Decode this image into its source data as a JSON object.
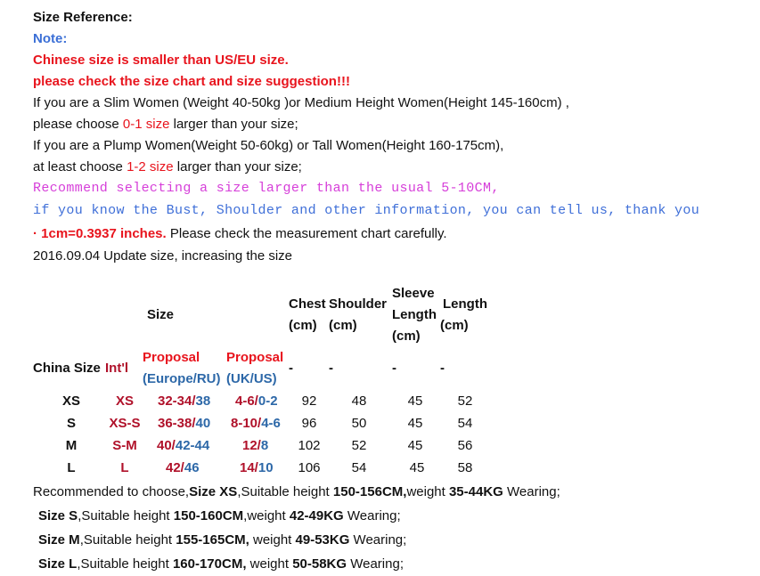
{
  "header": {
    "title": "Size Reference:",
    "note": "Note:",
    "warning1": "Chinese size is smaller than US/EU size.",
    "warning2": "please check the size chart and size suggestion!!!"
  },
  "advice": {
    "slim_line": "If you are a Slim Women (Weight 40-50kg )or Medium Height Women(Height 145-160cm) ,",
    "slim_pre": "please choose ",
    "slim_range": "0-1 size",
    "slim_post": " larger than your size;",
    "plump_line": "If you are a Plump Women(Weight 50-60kg) or Tall Women(Height 160-175cm),",
    "plump_pre": "at least choose ",
    "plump_range": "1-2 size",
    "plump_post": " larger than your size;",
    "recommend": "Recommend selecting a size larger than the usual 5-10CM,",
    "tell_us": "if you know the Bust, Shoulder and other information, you can tell us, thank you",
    "cm_bold": "· 1cm=0.3937 inches.",
    "cm_rest": " Please check the measurement chart carefully.",
    "update": "2016.09.04 Update size, increasing the size"
  },
  "table": {
    "size_header": "Size",
    "chest_header": "Chest",
    "chest_unit": "(cm)",
    "shoulder_header": "Shoulder",
    "shoulder_unit": "(cm)",
    "sleeve_header1": "Sleeve",
    "sleeve_header2": "Length",
    "sleeve_unit": "(cm)",
    "length_header": "Length",
    "length_unit": "(cm)",
    "china_size": "China Size",
    "intl": "Int'l",
    "proposal_eu": "Proposal",
    "proposal_eu_sub": "(Europe/RU)",
    "proposal_uk": "Proposal",
    "proposal_uk_sub": "(UK/US)",
    "dash": "-",
    "rows": [
      {
        "china": "XS",
        "intl": "XS",
        "eu_a": "32-34/",
        "eu_b": "38",
        "uk_a": "4-6/",
        "uk_b": "0-2",
        "chest": "92",
        "shoulder": "48",
        "sleeve": "45",
        "length": "52"
      },
      {
        "china": "S",
        "intl": "XS-S",
        "eu_a": "36-38/",
        "eu_b": "40",
        "uk_a": "8-10/",
        "uk_b": "4-6",
        "chest": "96",
        "shoulder": "50",
        "sleeve": "45",
        "length": "54"
      },
      {
        "china": "M",
        "intl": "S-M",
        "eu_a": "40/",
        "eu_b": "42-44",
        "uk_a": "12/",
        "uk_b": "8",
        "chest": "102",
        "shoulder": "52",
        "sleeve": "45",
        "length": "56"
      },
      {
        "china": "L",
        "intl": "L",
        "eu_a": "42/",
        "eu_b": "46",
        "uk_a": "14/",
        "uk_b": "10",
        "chest": "106",
        "shoulder": "54",
        "sleeve": "45",
        "length": "58"
      }
    ]
  },
  "suggestions": [
    {
      "pre": "Recommended to choose,",
      "size": "Size XS",
      "mid": ",Suitable height ",
      "height": "150-156CM,",
      "wlabel": "weight ",
      "weight": "35-44KG",
      "post": "  Wearing;"
    },
    {
      "pre": "",
      "size": "Size S",
      "mid": ",Suitable height ",
      "height": "150-160CM",
      "wlabel": ",weight ",
      "weight": "42-49KG",
      "post": "  Wearing;"
    },
    {
      "pre": "",
      "size": "Size M",
      "mid": ",Suitable height ",
      "height": "155-165CM,",
      "wlabel": " weight ",
      "weight": "49-53KG",
      "post": " Wearing;"
    },
    {
      "pre": "",
      "size": "Size L",
      "mid": ",Suitable height ",
      "height": "160-170CM,",
      "wlabel": " weight ",
      "weight": "50-58KG",
      "post": "  Wearing;"
    }
  ]
}
